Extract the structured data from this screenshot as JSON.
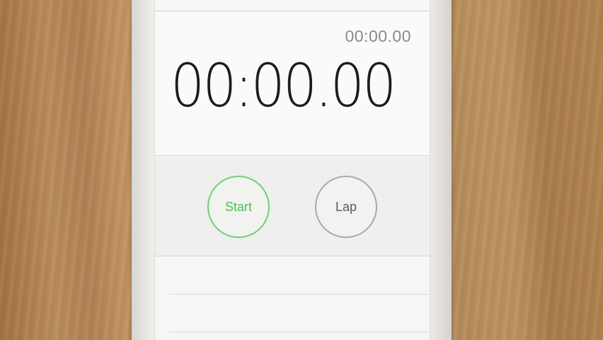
{
  "stopwatch": {
    "lap_time": "00:00.00",
    "main_time": "00:00.00"
  },
  "controls": {
    "start_label": "Start",
    "lap_label": "Lap"
  },
  "colors": {
    "start_accent": "#4cbf57",
    "lap_border": "#a9a9a9"
  },
  "laps": [
    {
      "label": ""
    },
    {
      "label": ""
    }
  ]
}
